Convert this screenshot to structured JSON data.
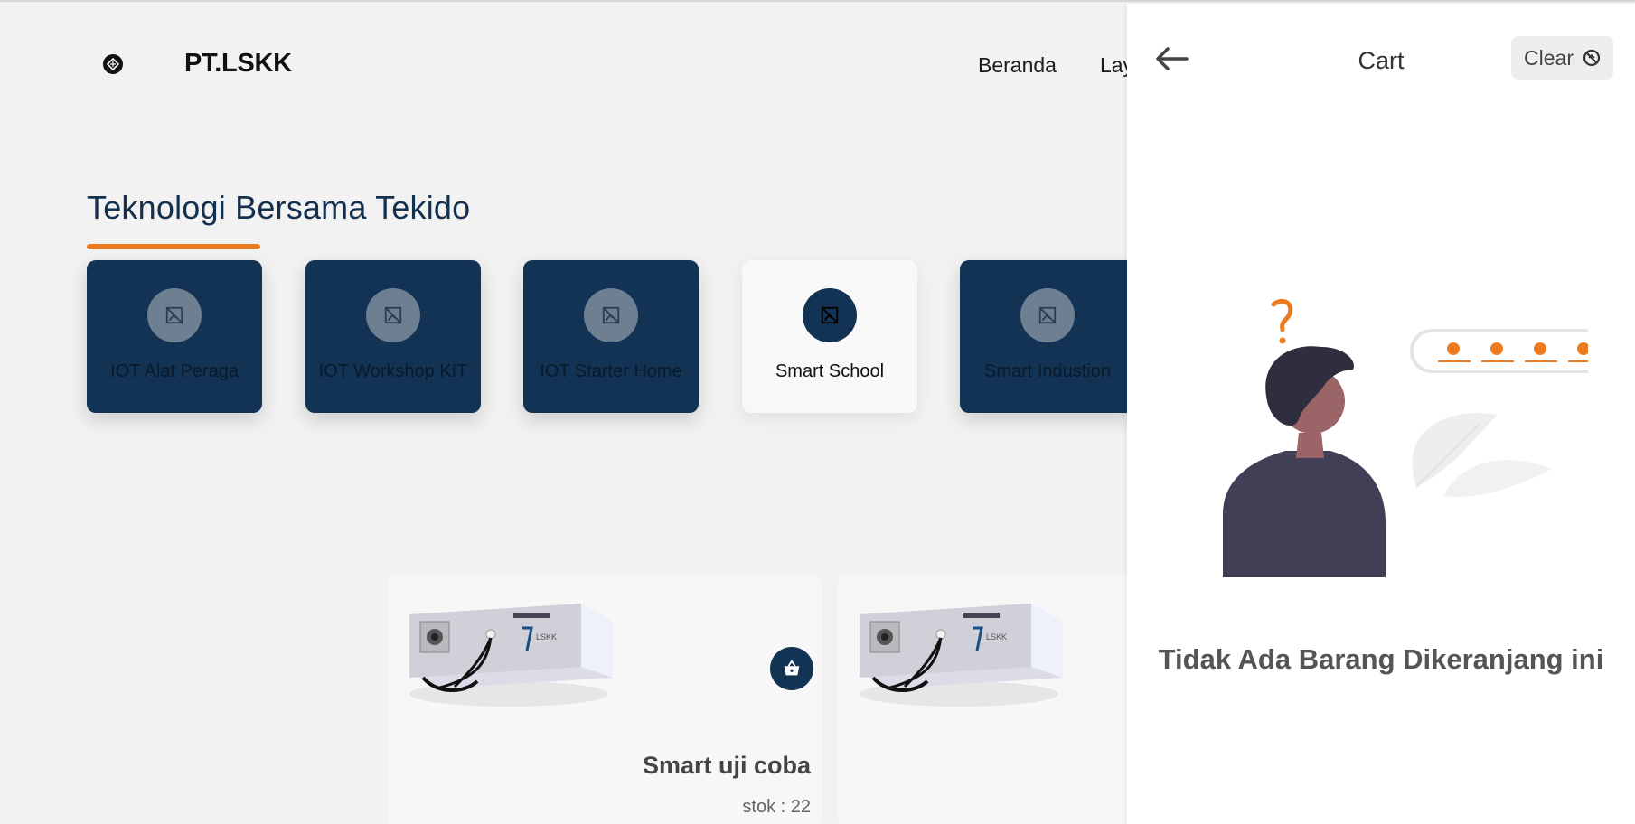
{
  "header": {
    "brand": "PT.LSKK",
    "logo_icon": "logo-icon",
    "nav": [
      "Beranda",
      "Layanan"
    ]
  },
  "section": {
    "title": "Teknologi Bersama Tekido",
    "accent_color": "#ea7c1f",
    "categories": [
      {
        "label": "IOT Alat Peraga",
        "icon": "broken-image-icon",
        "active": false
      },
      {
        "label": "IOT Workshop KIT",
        "icon": "broken-image-icon",
        "active": false
      },
      {
        "label": "IOT Starter Home",
        "icon": "broken-image-icon",
        "active": false
      },
      {
        "label": "Smart School",
        "icon": "broken-image-icon",
        "active": true
      },
      {
        "label": "Smart Industion",
        "icon": "broken-image-icon",
        "active": false
      }
    ]
  },
  "products": [
    {
      "name": "Smart uji coba",
      "stock": "stok : 22",
      "image": "device-product-image",
      "cart_icon": "basket-icon"
    },
    {
      "name": "",
      "stock": "",
      "image": "device-product-image"
    }
  ],
  "cart": {
    "back_icon": "arrow-left-icon",
    "title": "Cart",
    "clear_label": "Clear",
    "clear_icon": "clear-circle-icon",
    "empty_message": "Tidak Ada Barang Dikeranjang ini",
    "illustration": "confused-person-illustration"
  },
  "colors": {
    "navy": "#123354",
    "background": "#f3f2f2",
    "accent": "#ea7c1f"
  }
}
